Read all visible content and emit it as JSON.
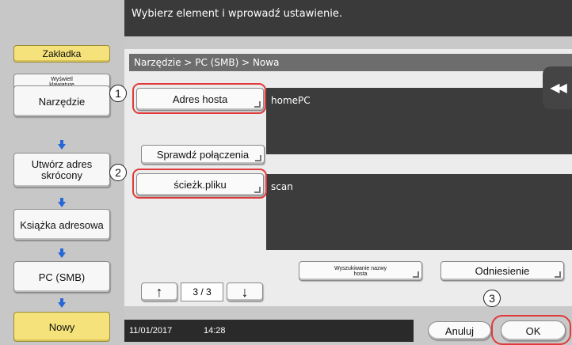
{
  "header": {
    "message": "Wybierz element i wprowadź ustawienie."
  },
  "breadcrumb": "Narzędzie > PC (SMB) > Nowa",
  "sidebar": {
    "bookmark": "Zakładka",
    "keyboard": "Wyświetl klawiaturę",
    "steps": [
      "Narzędzie",
      "Utwórz adres skrócony",
      "Książka adresowa",
      "PC (SMB)",
      "Nowy"
    ]
  },
  "form": {
    "host_button": "Adres hosta",
    "host_value": "homePC",
    "check_button": "Sprawdź połączenia",
    "path_button": "ścieżk.pliku",
    "path_value": "scan",
    "search_host_button": "Wyszukiwanie nazwy hosta",
    "reference_button": "Odniesienie"
  },
  "pager": {
    "up_symbol": "↑",
    "down_symbol": "↓",
    "page": "3 / 3"
  },
  "footer": {
    "date": "11/01/2017",
    "time": "14:28",
    "cancel": "Anuluj",
    "ok": "OK"
  },
  "markers": [
    "1",
    "2",
    "3"
  ],
  "rewind_symbol": "◀◀",
  "colors": {
    "accent_yellow": "#f5e27a",
    "arrow_blue": "#2667d8",
    "highlight_red": "#e03a3a"
  }
}
